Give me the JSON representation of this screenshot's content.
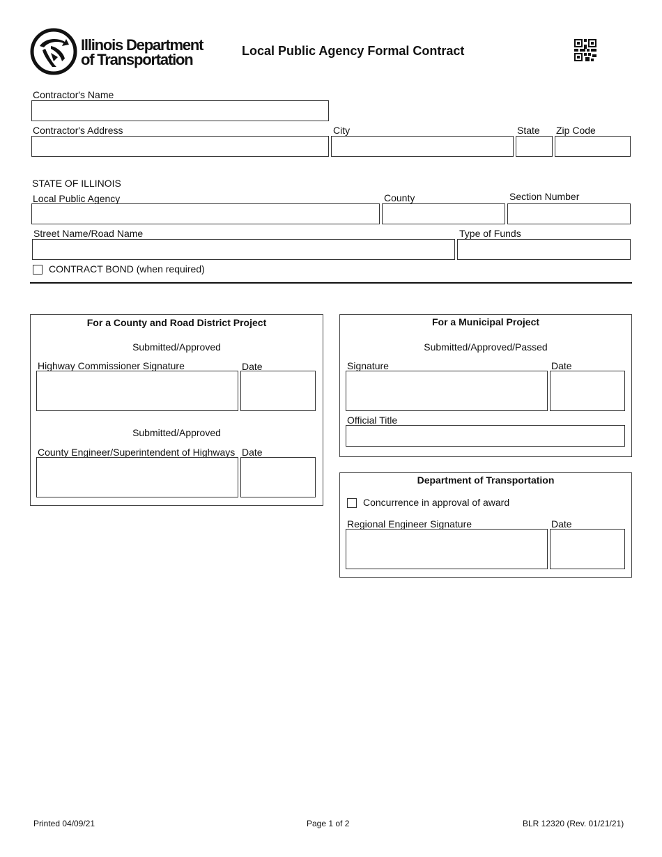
{
  "header": {
    "logo_line1": "Illinois Department",
    "logo_line2": "of Transportation",
    "title": "Local Public Agency Formal Contract",
    "qr_icon": "qr-code-icon"
  },
  "contractor": {
    "name_label": "Contractor's Name",
    "name_value": "",
    "address_label": "Contractor's Address",
    "address_value": "",
    "city_label": "City",
    "city_value": "",
    "state_label": "State",
    "state_value": "",
    "zip_label": "Zip Code",
    "zip_value": ""
  },
  "agency": {
    "state_heading": "STATE OF ILLINOIS",
    "lpa_label": "Local Public Agency",
    "lpa_value": "",
    "county_label": "County",
    "county_value": "",
    "section_label": "Section Number",
    "section_value": "",
    "street_label": "Street Name/Road Name",
    "street_value": "",
    "funds_label": "Type of Funds",
    "funds_value": "",
    "bond_label": "CONTRACT BOND (when required)",
    "bond_checked": false
  },
  "county_panel": {
    "title": "For a County and Road District Project",
    "sub1": "Submitted/Approved",
    "sig1_label": "Highway Commissioner Signature",
    "date1_label": "Date",
    "sub2": "Submitted/Approved",
    "sig2_label": "County Engineer/Superintendent of Highways",
    "date2_label": "Date"
  },
  "municipal_panel": {
    "title": "For a Municipal Project",
    "sub": "Submitted/Approved/Passed",
    "sig_label": "Signature",
    "date_label": "Date",
    "official_title_label": "Official Title"
  },
  "dot_panel": {
    "title": "Department of Transportation",
    "concurrence_label": "Concurrence in approval of award",
    "concurrence_checked": false,
    "sig_label": "Regional Engineer Signature",
    "date_label": "Date"
  },
  "footer": {
    "printed": "Printed 04/09/21",
    "page": "Page 1 of 2",
    "form_id": "BLR 12320 (Rev. 01/21/21)"
  }
}
